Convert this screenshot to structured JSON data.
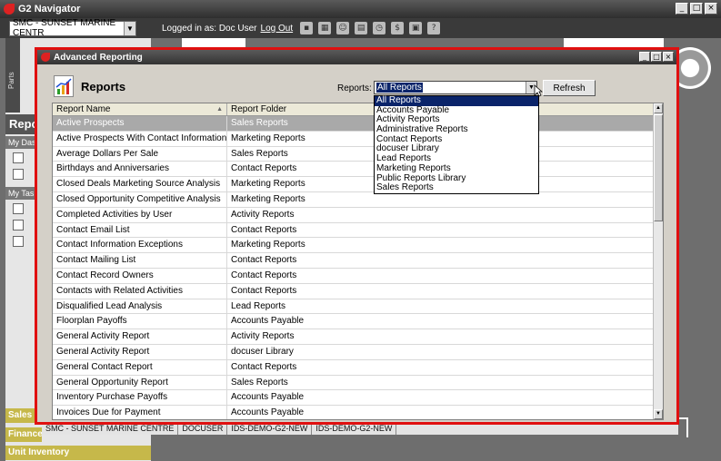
{
  "app": {
    "title": "G2 Navigator",
    "company_value": "SMC - SUNSET MARINE CENTR",
    "logged_in_text": "Logged in as: Doc User",
    "logout_label": "Log Out",
    "parts_label": "Parts",
    "left_header": "Repo",
    "my_dash_label": "My Das",
    "my_tasks_label": "My Task",
    "bottom_tabs": [
      "Sales",
      "Finance",
      "Unit Inventory"
    ],
    "status_items": [
      "SMC - SUNSET MARINE CENTRE",
      "DOCUSER",
      "IDS-DEMO-G2-NEW",
      "IDS-DEMO-G2-NEW"
    ]
  },
  "dialog": {
    "title": "Advanced Reporting",
    "heading": "Reports",
    "reports_label": "Reports:",
    "selected_report": "All Reports",
    "refresh_label": "Refresh",
    "columns": {
      "name": "Report Name",
      "folder": "Report Folder"
    },
    "dropdown_options": [
      "All Reports",
      "Accounts Payable",
      "Activity Reports",
      "Administrative Reports",
      "Contact Reports",
      "docuser Library",
      "Lead Reports",
      "Marketing Reports",
      "Public Reports Library",
      "Sales Reports"
    ],
    "rows": [
      {
        "name": "Active Prospects",
        "folder": "Sales Reports"
      },
      {
        "name": "Active Prospects With Contact Information",
        "folder": "Marketing Reports"
      },
      {
        "name": "Average Dollars Per Sale",
        "folder": "Sales Reports"
      },
      {
        "name": "Birthdays and Anniversaries",
        "folder": "Contact Reports"
      },
      {
        "name": "Closed Deals Marketing Source Analysis",
        "folder": "Marketing Reports"
      },
      {
        "name": "Closed Opportunity Competitive Analysis",
        "folder": "Marketing Reports"
      },
      {
        "name": "Completed Activities by User",
        "folder": "Activity Reports"
      },
      {
        "name": "Contact Email List",
        "folder": "Contact Reports"
      },
      {
        "name": "Contact Information Exceptions",
        "folder": "Marketing Reports"
      },
      {
        "name": "Contact Mailing List",
        "folder": "Contact Reports"
      },
      {
        "name": "Contact Record Owners",
        "folder": "Contact Reports"
      },
      {
        "name": "Contacts with Related Activities",
        "folder": "Contact Reports"
      },
      {
        "name": "Disqualified Lead Analysis",
        "folder": "Lead Reports"
      },
      {
        "name": "Floorplan Payoffs",
        "folder": "Accounts Payable"
      },
      {
        "name": "General Activity Report",
        "folder": "Activity Reports"
      },
      {
        "name": "General Activity Report",
        "folder": "docuser Library"
      },
      {
        "name": "General Contact Report",
        "folder": "Contact Reports"
      },
      {
        "name": "General Opportunity Report",
        "folder": "Sales Reports"
      },
      {
        "name": "Inventory Purchase Payoffs",
        "folder": "Accounts Payable"
      },
      {
        "name": "Invoices Due for Payment",
        "folder": "Accounts Payable"
      }
    ]
  }
}
